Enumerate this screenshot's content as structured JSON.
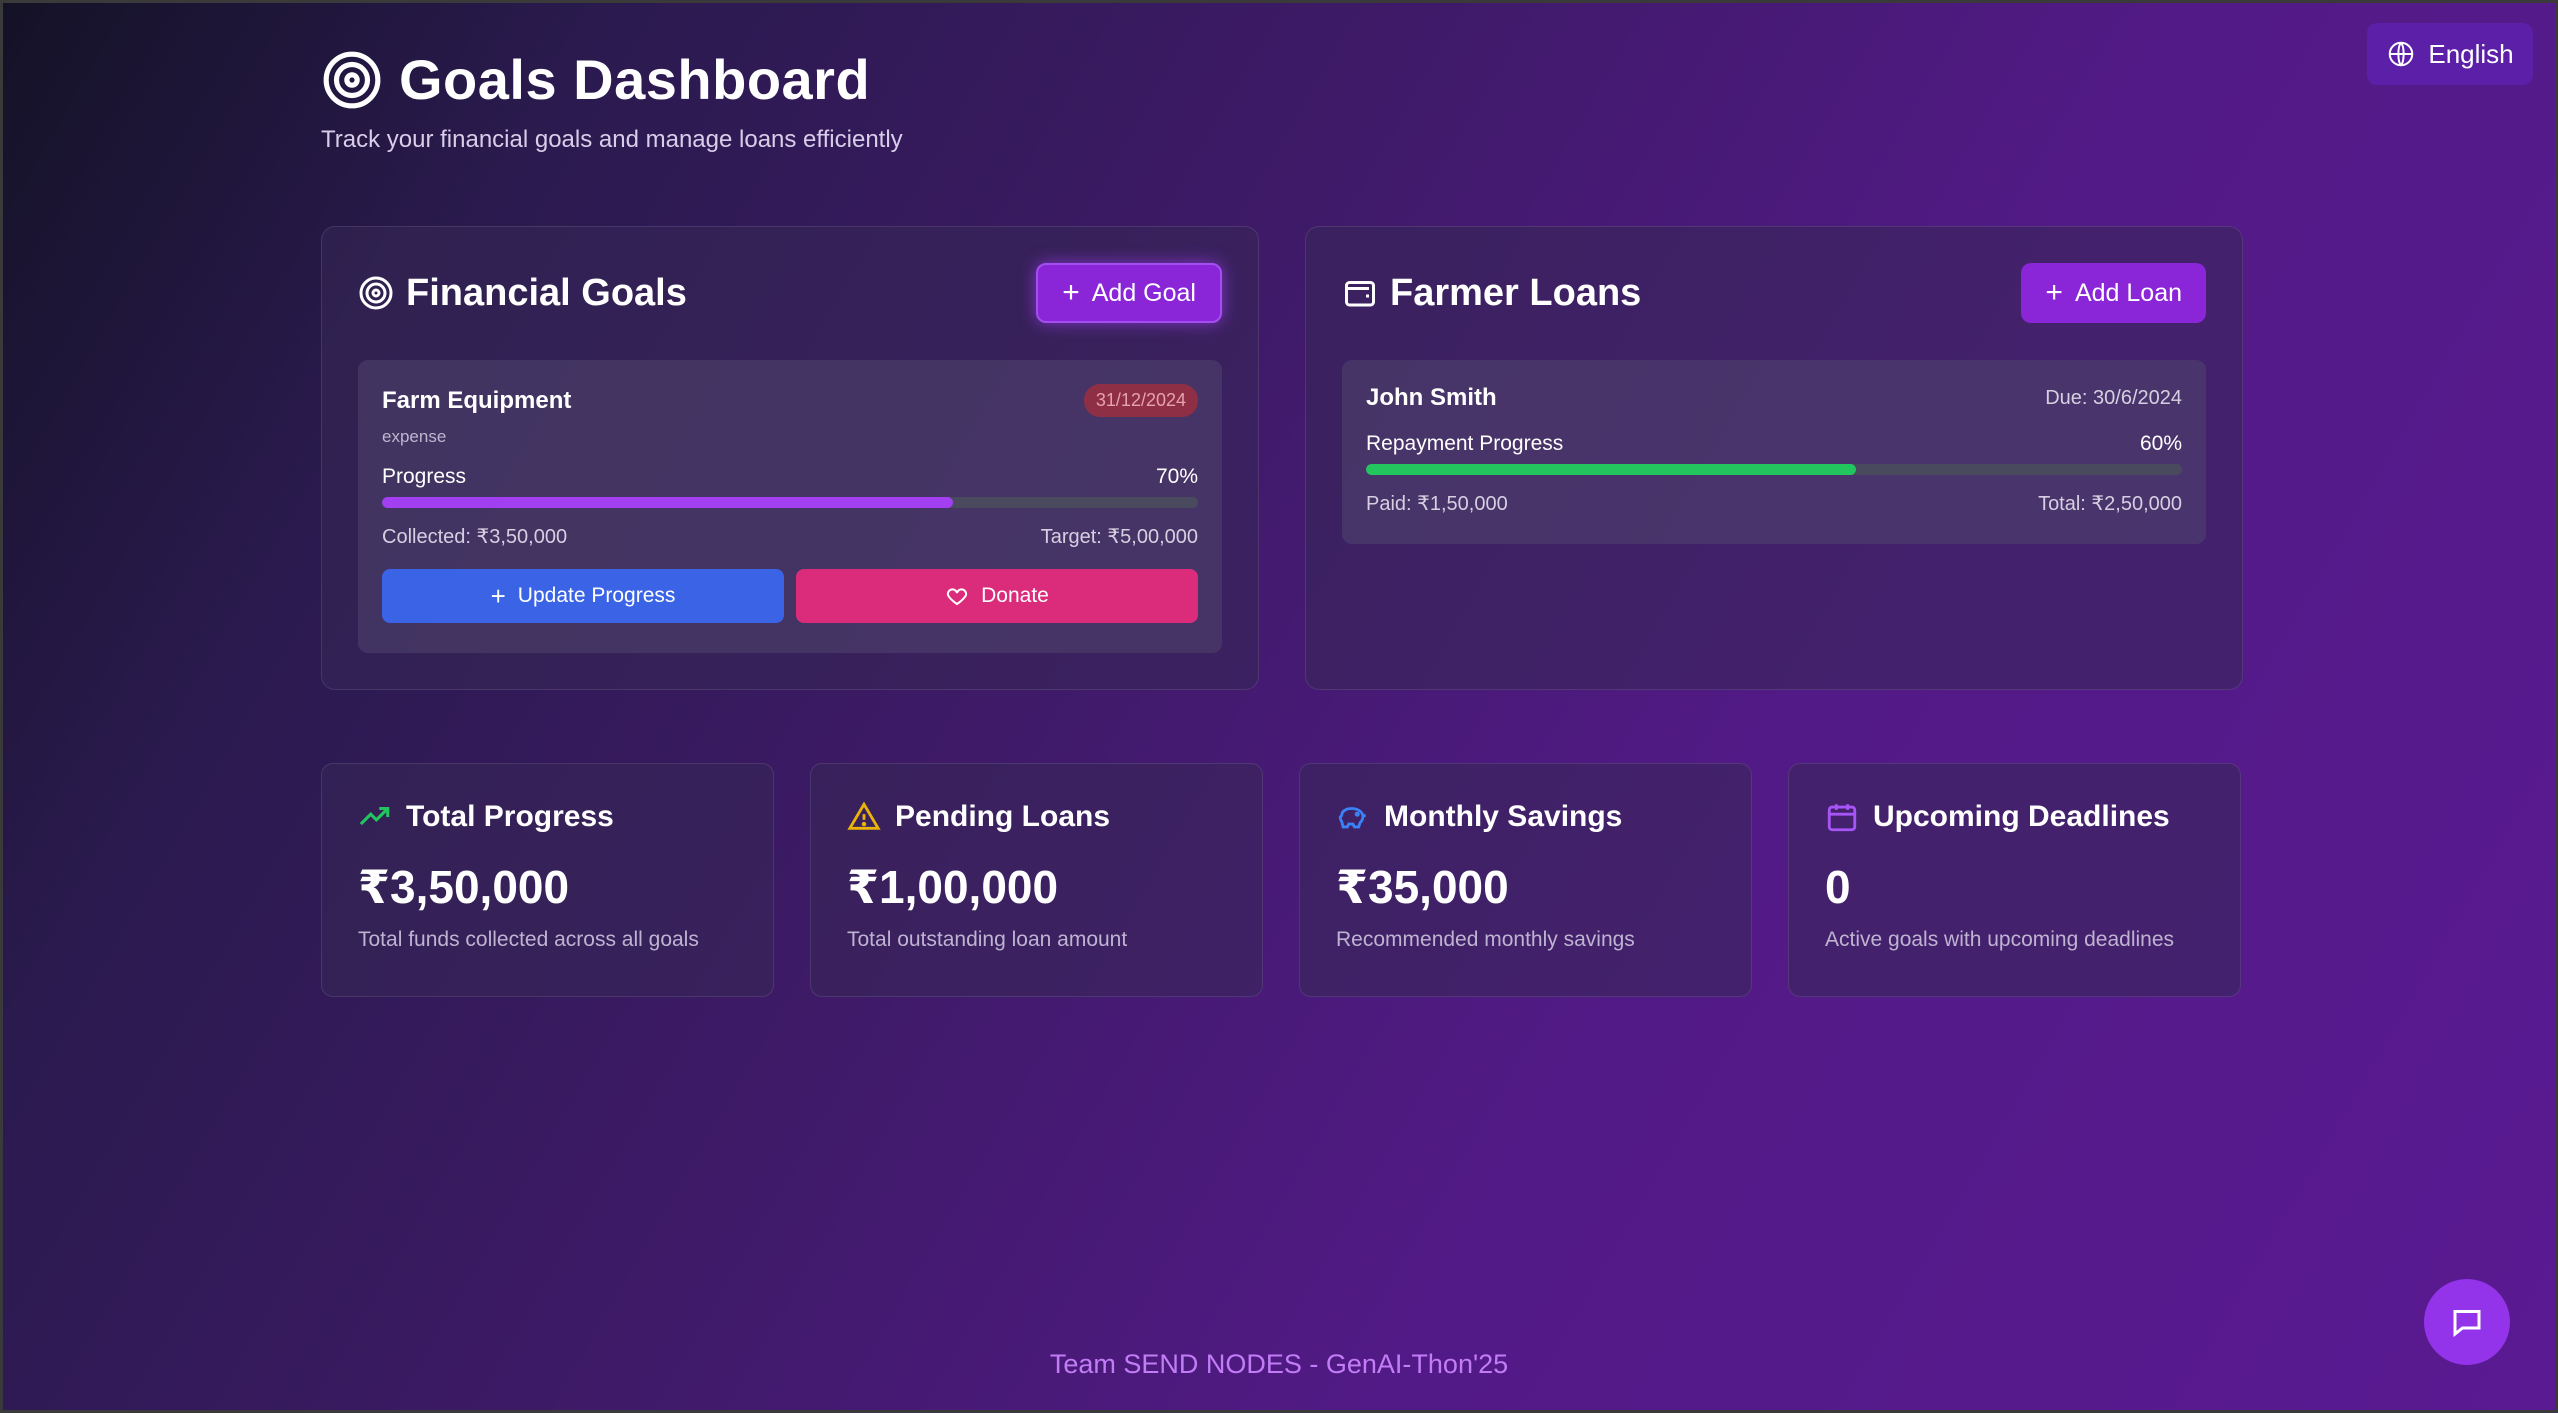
{
  "language": {
    "label": "English",
    "icon": "globe-icon"
  },
  "header": {
    "title": "Goals Dashboard",
    "subtitle": "Track your financial goals and manage loans efficiently",
    "icon": "target-icon"
  },
  "goals_panel": {
    "title": "Financial Goals",
    "add_label": "Add Goal",
    "goals": [
      {
        "name": "Farm Equipment",
        "date": "31/12/2024",
        "type": "expense",
        "progress_label": "Progress",
        "progress_percent": "70%",
        "progress_value": 0.7,
        "collected": "Collected: ₹3,50,000",
        "target": "Target: ₹5,00,000",
        "update_label": "Update Progress",
        "donate_label": "Donate"
      }
    ]
  },
  "loans_panel": {
    "title": "Farmer Loans",
    "add_label": "Add Loan",
    "loans": [
      {
        "name": "John Smith",
        "due": "Due: 30/6/2024",
        "progress_label": "Repayment Progress",
        "progress_percent": "60%",
        "progress_value": 0.6,
        "paid": "Paid: ₹1,50,000",
        "total": "Total: ₹2,50,000"
      }
    ]
  },
  "stats": [
    {
      "title": "Total Progress",
      "value": "₹3,50,000",
      "desc": "Total funds collected across all goals",
      "icon": "trending-up-icon",
      "color": "#22c55e"
    },
    {
      "title": "Pending Loans",
      "value": "₹1,00,000",
      "desc": "Total outstanding loan amount",
      "icon": "warning-icon",
      "color": "#eab308"
    },
    {
      "title": "Monthly Savings",
      "value": "₹35,000",
      "desc": "Recommended monthly savings",
      "icon": "piggy-bank-icon",
      "color": "#3b82f6"
    },
    {
      "title": "Upcoming Deadlines",
      "value": "0",
      "desc": "Active goals with upcoming deadlines",
      "icon": "calendar-icon",
      "color": "#a855f7"
    }
  ],
  "footer": {
    "text": "Team SEND NODES - GenAI-Thon'25"
  },
  "chat": {
    "icon": "chat-icon"
  },
  "colors": {
    "accent": "#8a26d8",
    "goal_bar": "#a23ff0",
    "loan_bar": "#22c55e",
    "donate": "#db2b7b",
    "update": "#3a63e6"
  }
}
